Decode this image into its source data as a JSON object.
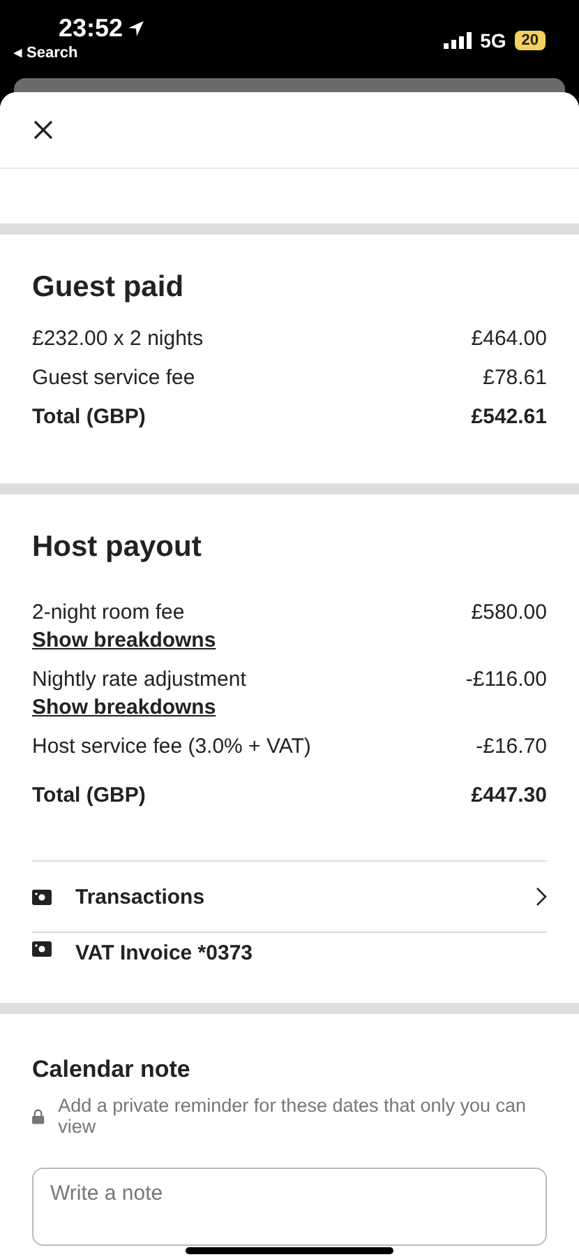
{
  "status_bar": {
    "time": "23:52",
    "back_label": "◂ Search",
    "network": "5G",
    "battery": "20"
  },
  "guest_paid": {
    "title": "Guest paid",
    "rows": [
      {
        "label": "£232.00 x 2 nights",
        "value": "£464.00",
        "kind": "line"
      },
      {
        "label": "Guest service fee",
        "value": "£78.61",
        "kind": "line"
      },
      {
        "label": "Total (GBP)",
        "value": "£542.61",
        "kind": "total"
      }
    ]
  },
  "host_payout": {
    "title": "Host payout",
    "rows": [
      {
        "label": "2-night room fee",
        "value": "£580.00",
        "kind": "line",
        "link": "Show breakdowns"
      },
      {
        "label": "Nightly rate adjustment",
        "value": "-£116.00",
        "kind": "line",
        "link": "Show breakdowns"
      },
      {
        "label": "Host service fee (3.0% + VAT)",
        "value": "-£16.70",
        "kind": "line"
      },
      {
        "label": "Total (GBP)",
        "value": "£447.30",
        "kind": "total"
      }
    ]
  },
  "links": [
    {
      "label": "Transactions",
      "chevron": true
    },
    {
      "label": "VAT Invoice *0373",
      "chevron": false
    }
  ],
  "calendar_note": {
    "title": "Calendar note",
    "hint": "Add a private reminder for these dates that only you can view",
    "placeholder": "Write a note"
  }
}
